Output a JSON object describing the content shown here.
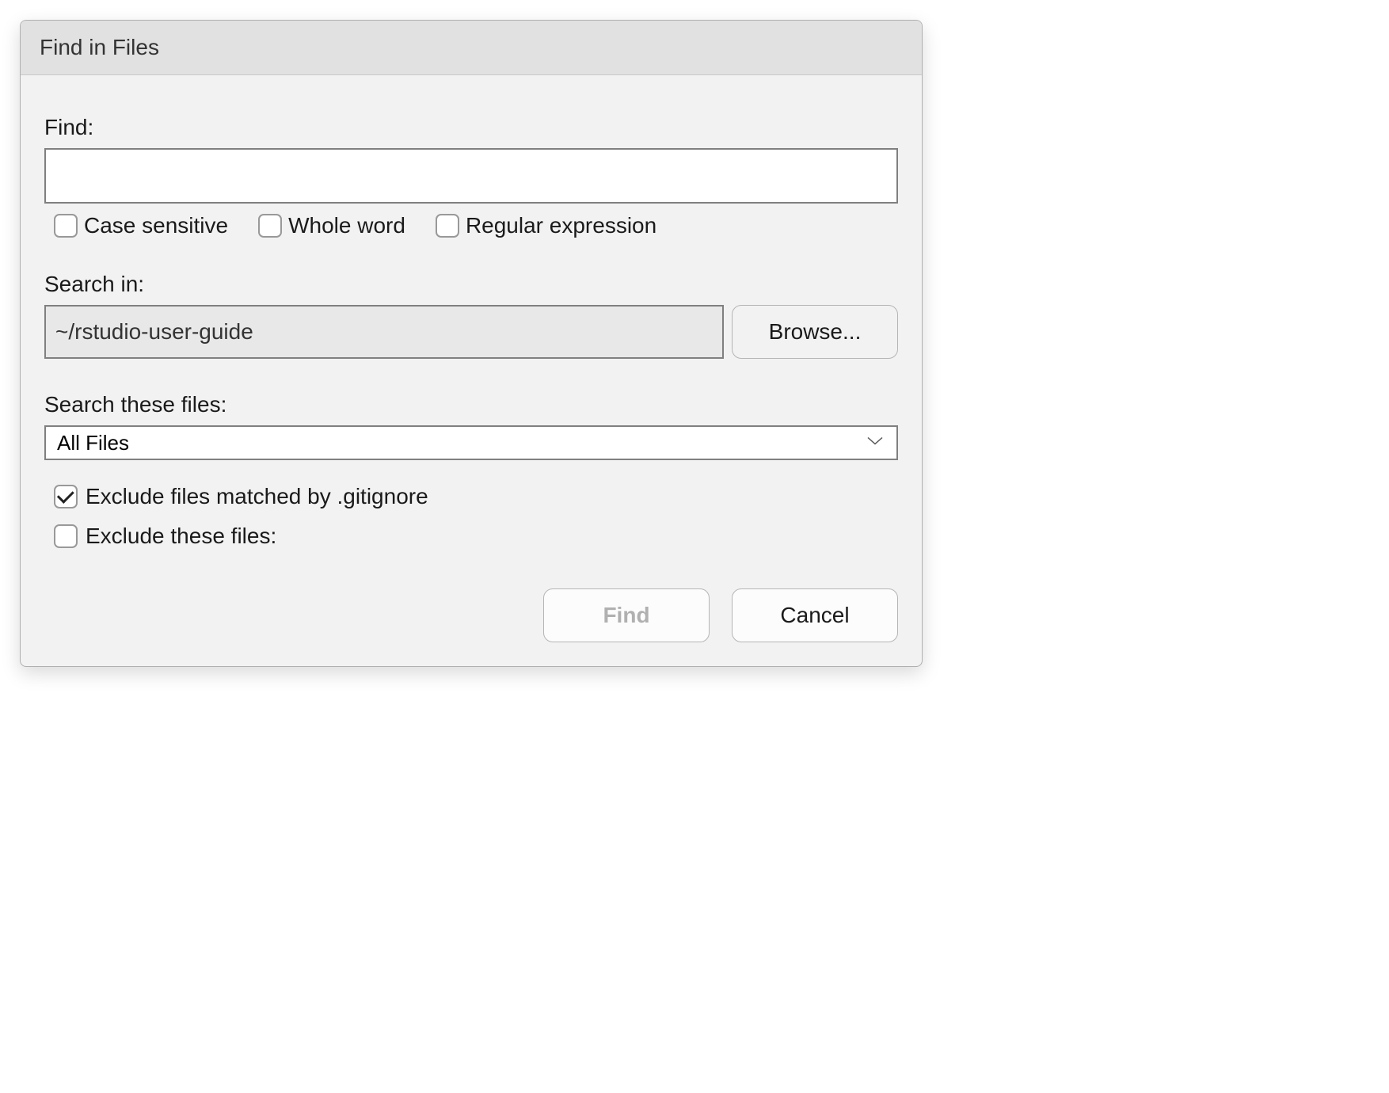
{
  "dialog": {
    "title": "Find in Files"
  },
  "find": {
    "label": "Find:",
    "value": "",
    "options": {
      "case_sensitive": {
        "label": "Case sensitive",
        "checked": false
      },
      "whole_word": {
        "label": "Whole word",
        "checked": false
      },
      "regex": {
        "label": "Regular expression",
        "checked": false
      }
    }
  },
  "search_in": {
    "label": "Search in:",
    "value": "~/rstudio-user-guide",
    "browse_label": "Browse..."
  },
  "search_files": {
    "label": "Search these files:",
    "selected": "All Files"
  },
  "exclude": {
    "gitignore": {
      "label": "Exclude files matched by .gitignore",
      "checked": true
    },
    "these_files": {
      "label": "Exclude these files:",
      "checked": false
    }
  },
  "buttons": {
    "find": "Find",
    "cancel": "Cancel"
  }
}
